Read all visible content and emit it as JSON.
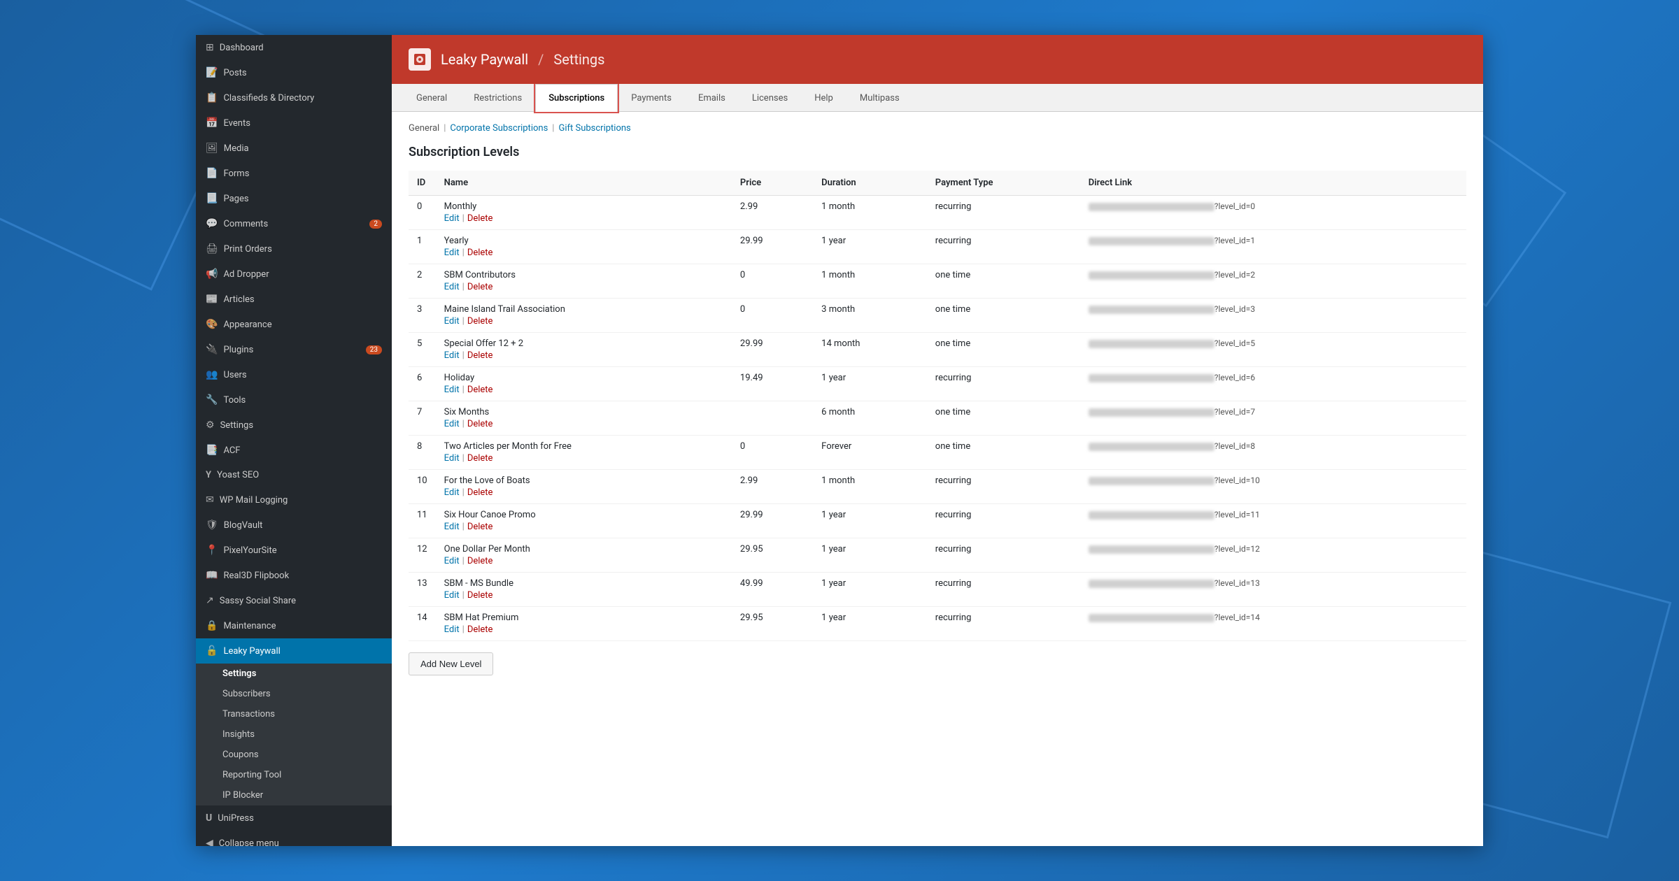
{
  "app": {
    "title": "Leaky Paywall",
    "separator": "/",
    "subtitle": "Settings",
    "icon": "🔒"
  },
  "sidebar": {
    "items": [
      {
        "id": "dashboard",
        "label": "Dashboard",
        "icon": "⊞",
        "active": false
      },
      {
        "id": "posts",
        "label": "Posts",
        "icon": "📝",
        "active": false
      },
      {
        "id": "classifieds",
        "label": "Classifieds & Directory",
        "icon": "📋",
        "active": false
      },
      {
        "id": "events",
        "label": "Events",
        "icon": "📅",
        "active": false
      },
      {
        "id": "media",
        "label": "Media",
        "icon": "🖼",
        "active": false
      },
      {
        "id": "forms",
        "label": "Forms",
        "icon": "📄",
        "active": false
      },
      {
        "id": "pages",
        "label": "Pages",
        "icon": "📃",
        "active": false
      },
      {
        "id": "comments",
        "label": "Comments",
        "icon": "💬",
        "badge": "2",
        "active": false
      },
      {
        "id": "print-orders",
        "label": "Print Orders",
        "icon": "🖨",
        "active": false
      },
      {
        "id": "ad-dropper",
        "label": "Ad Dropper",
        "icon": "📢",
        "active": false
      },
      {
        "id": "articles",
        "label": "Articles",
        "icon": "📰",
        "active": false
      },
      {
        "id": "appearance",
        "label": "Appearance",
        "icon": "🎨",
        "active": false
      },
      {
        "id": "plugins",
        "label": "Plugins",
        "icon": "🔌",
        "badge": "23",
        "active": false
      },
      {
        "id": "users",
        "label": "Users",
        "icon": "👥",
        "active": false
      },
      {
        "id": "tools",
        "label": "Tools",
        "icon": "🔧",
        "active": false
      },
      {
        "id": "settings",
        "label": "Settings",
        "icon": "⚙",
        "active": false
      },
      {
        "id": "acf",
        "label": "ACF",
        "icon": "📑",
        "active": false
      },
      {
        "id": "yoast",
        "label": "Yoast SEO",
        "icon": "Y",
        "active": false
      },
      {
        "id": "wp-mail-logging",
        "label": "WP Mail Logging",
        "icon": "✉",
        "active": false
      },
      {
        "id": "blogvault",
        "label": "BlogVault",
        "icon": "🛡",
        "active": false
      },
      {
        "id": "pixelyoursite",
        "label": "PixelYourSite",
        "icon": "📍",
        "active": false
      },
      {
        "id": "real3d",
        "label": "Real3D Flipbook",
        "icon": "📖",
        "active": false
      },
      {
        "id": "sassy-social",
        "label": "Sassy Social Share",
        "icon": "↗",
        "active": false
      },
      {
        "id": "maintenance",
        "label": "Maintenance",
        "icon": "🔒",
        "active": false
      },
      {
        "id": "leaky-paywall",
        "label": "Leaky Paywall",
        "icon": "🔓",
        "active": true
      }
    ],
    "submenu": [
      {
        "id": "settings-sub",
        "label": "Settings",
        "active": true
      },
      {
        "id": "subscribers",
        "label": "Subscribers",
        "active": false
      },
      {
        "id": "transactions",
        "label": "Transactions",
        "active": false
      },
      {
        "id": "insights",
        "label": "Insights",
        "active": false
      },
      {
        "id": "coupons",
        "label": "Coupons",
        "active": false
      },
      {
        "id": "reporting-tool",
        "label": "Reporting Tool",
        "active": false
      },
      {
        "id": "ip-blocker",
        "label": "IP Blocker",
        "active": false
      }
    ],
    "extra_items": [
      {
        "id": "unipress",
        "label": "UniPress",
        "icon": "U"
      },
      {
        "id": "collapse",
        "label": "Collapse menu",
        "icon": "◀"
      }
    ]
  },
  "tabs": [
    {
      "id": "general",
      "label": "General",
      "active": false
    },
    {
      "id": "restrictions",
      "label": "Restrictions",
      "active": false
    },
    {
      "id": "subscriptions",
      "label": "Subscriptions",
      "active": true
    },
    {
      "id": "payments",
      "label": "Payments",
      "active": false
    },
    {
      "id": "emails",
      "label": "Emails",
      "active": false
    },
    {
      "id": "licenses",
      "label": "Licenses",
      "active": false
    },
    {
      "id": "help",
      "label": "Help",
      "active": false
    },
    {
      "id": "multipass",
      "label": "Multipass",
      "active": false
    }
  ],
  "breadcrumb": {
    "general": "General",
    "corporate": "Corporate Subscriptions",
    "gift": "Gift Subscriptions"
  },
  "section": {
    "title": "Subscription Levels"
  },
  "table": {
    "headers": [
      "ID",
      "Name",
      "Price",
      "Duration",
      "Payment Type",
      "Direct Link"
    ],
    "rows": [
      {
        "id": "0",
        "name": "Monthly",
        "price": "2.99",
        "duration": "1 month",
        "payment_type": "recurring",
        "link_suffix": "?level_id=0"
      },
      {
        "id": "1",
        "name": "Yearly",
        "price": "29.99",
        "duration": "1 year",
        "payment_type": "recurring",
        "link_suffix": "?level_id=1"
      },
      {
        "id": "2",
        "name": "SBM Contributors",
        "price": "0",
        "duration": "1 month",
        "payment_type": "one time",
        "link_suffix": "?level_id=2"
      },
      {
        "id": "3",
        "name": "Maine Island Trail Association",
        "price": "0",
        "duration": "3 month",
        "payment_type": "one time",
        "link_suffix": "?level_id=3"
      },
      {
        "id": "5",
        "name": "Special Offer 12 + 2",
        "price": "29.99",
        "duration": "14 month",
        "payment_type": "one time",
        "link_suffix": "?level_id=5"
      },
      {
        "id": "6",
        "name": "Holiday",
        "price": "19.49",
        "duration": "1 year",
        "payment_type": "recurring",
        "link_suffix": "?level_id=6"
      },
      {
        "id": "7",
        "name": "Six Months",
        "price": "",
        "duration": "6 month",
        "payment_type": "one time",
        "link_suffix": "?level_id=7"
      },
      {
        "id": "8",
        "name": "Two Articles per Month for Free",
        "price": "0",
        "duration": "Forever",
        "payment_type": "one time",
        "link_suffix": "?level_id=8"
      },
      {
        "id": "10",
        "name": "For the Love of Boats",
        "price": "2.99",
        "duration": "1 month",
        "payment_type": "recurring",
        "link_suffix": "?level_id=10"
      },
      {
        "id": "11",
        "name": "Six Hour Canoe Promo",
        "price": "29.99",
        "duration": "1 year",
        "payment_type": "recurring",
        "link_suffix": "?level_id=11"
      },
      {
        "id": "12",
        "name": "One Dollar Per Month",
        "price": "29.95",
        "duration": "1 year",
        "payment_type": "recurring",
        "link_suffix": "?level_id=12"
      },
      {
        "id": "13",
        "name": "SBM - MS Bundle",
        "price": "49.99",
        "duration": "1 year",
        "payment_type": "recurring",
        "link_suffix": "?level_id=13"
      },
      {
        "id": "14",
        "name": "SBM Hat Premium",
        "price": "29.95",
        "duration": "1 year",
        "payment_type": "recurring",
        "link_suffix": "?level_id=14"
      }
    ]
  },
  "actions": {
    "edit": "Edit",
    "delete": "Delete",
    "add_new_level": "Add New Level"
  },
  "link_parts": {
    "prefix": ".com/register/",
    "suffix_label": ".com/register/"
  }
}
